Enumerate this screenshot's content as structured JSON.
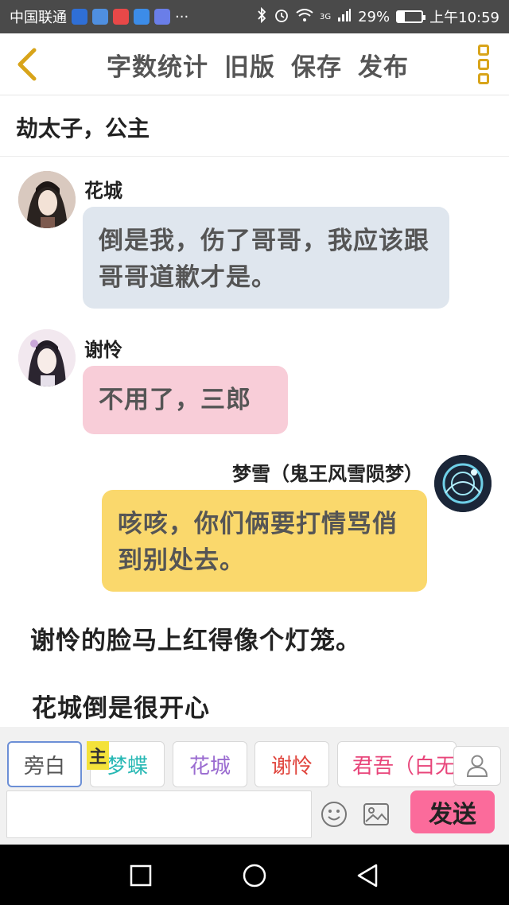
{
  "status": {
    "carrier": "中国联通",
    "more": "···",
    "network": "3G",
    "battery_percent": "29%",
    "battery_level": 0.29,
    "time": "上午10:59"
  },
  "toolbar": {
    "actions": [
      "字数统计",
      "旧版",
      "保存",
      "发布"
    ],
    "accent": "#d8a41a"
  },
  "chapter_title": "劫太子，公主",
  "messages": [
    {
      "speaker": "花城",
      "text": "倒是我，伤了哥哥，我应该跟哥哥道歉才是。",
      "bg": "#dfe6ee"
    },
    {
      "speaker": "谢怜",
      "text": "不用了，三郎",
      "bg": "#f8cdd8"
    },
    {
      "speaker": "梦雪（鬼王风雪陨梦）",
      "text": "咳咳，你们俩要打情骂俏到别处去。",
      "bg": "#fad86c"
    }
  ],
  "narration": [
    "谢怜的脸马上红得像个灯笼。",
    "花城倒是很开心"
  ],
  "roles": {
    "lead_tag": "主",
    "items": [
      {
        "label": "旁白",
        "color": "#555555"
      },
      {
        "label": "梦蝶",
        "color": "#28b8b4"
      },
      {
        "label": "花城",
        "color": "#9a6bd0"
      },
      {
        "label": "谢怜",
        "color": "#e0443c"
      },
      {
        "label": "君吾（白无相）",
        "color": "#e8457a"
      }
    ]
  },
  "input": {
    "placeholder": "",
    "send_label": "发送"
  }
}
